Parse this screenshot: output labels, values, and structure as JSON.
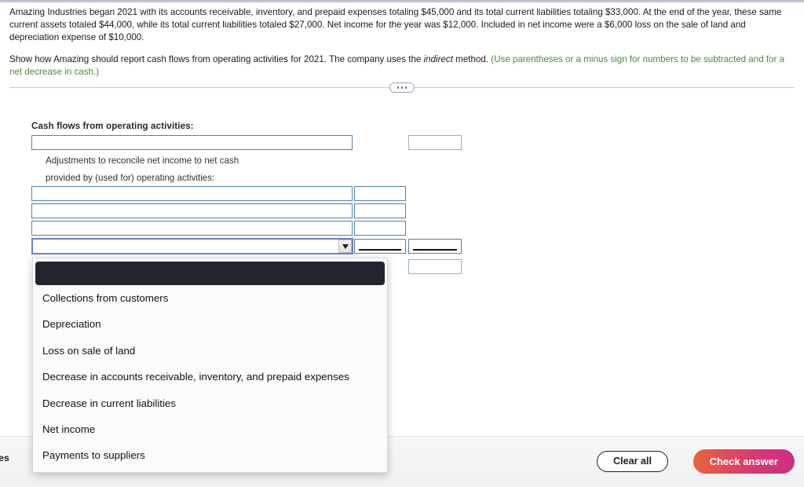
{
  "problem": {
    "paragraph1_part1": "Amazing Industries began 2021 with its accounts receivable, inventory, and prepaid expenses totaling $45,000 and its total current liabilities totaling $33,000. At the end of the year, these same current assets totaled $44,000, while its total current liabilities totaled $27,000. Net income for the year was $12,000. Included in net income were a $6,000 loss on the sale of land and depreciation expense of $10,000.",
    "paragraph2_lead": "Show how Amazing should report cash flows from operating activities for 2021. The company uses the ",
    "paragraph2_italic": "indirect",
    "paragraph2_mid": " method. ",
    "paragraph2_hint": "(Use parentheses or a minus sign for numbers to be subtracted and for a net decrease in cash.)"
  },
  "divider": {
    "handle_icon": "ellipsis-handle-icon"
  },
  "worksheet": {
    "title": "Cash flows from operating activities:",
    "sub_line_1": "Adjustments to reconcile net income to net cash",
    "sub_line_2": "provided by (used for) operating activities:",
    "rows": [
      {
        "label_value": "",
        "amount_value": ""
      },
      {
        "label_value": "",
        "amount_value": ""
      },
      {
        "label_value": "",
        "amount_value": ""
      },
      {
        "label_value": "",
        "amount_value": ""
      },
      {
        "label_value": "",
        "amount_value": ""
      }
    ]
  },
  "dropdown": {
    "arrow_icon": "chevron-down-icon",
    "selected_option": "",
    "options": [
      "Collections from customers",
      "Depreciation",
      "Loss on sale of land",
      "Decrease in accounts receivable, inventory, and prepaid expenses",
      "Decrease in current liabilities",
      "Net income",
      "Payments to suppliers"
    ]
  },
  "bottom_bar": {
    "truncated_label": "es",
    "clear_all_label": "Clear all",
    "check_answer_label": "Check answer"
  },
  "colors": {
    "hint_green": "#4b8b3b",
    "box_border": "#4f83a8",
    "focus_border": "#6f7ed8",
    "dropdown_selected_bg": "#20252f",
    "check_gradient_from": "#e8663a",
    "check_gradient_to": "#cc2d86"
  }
}
